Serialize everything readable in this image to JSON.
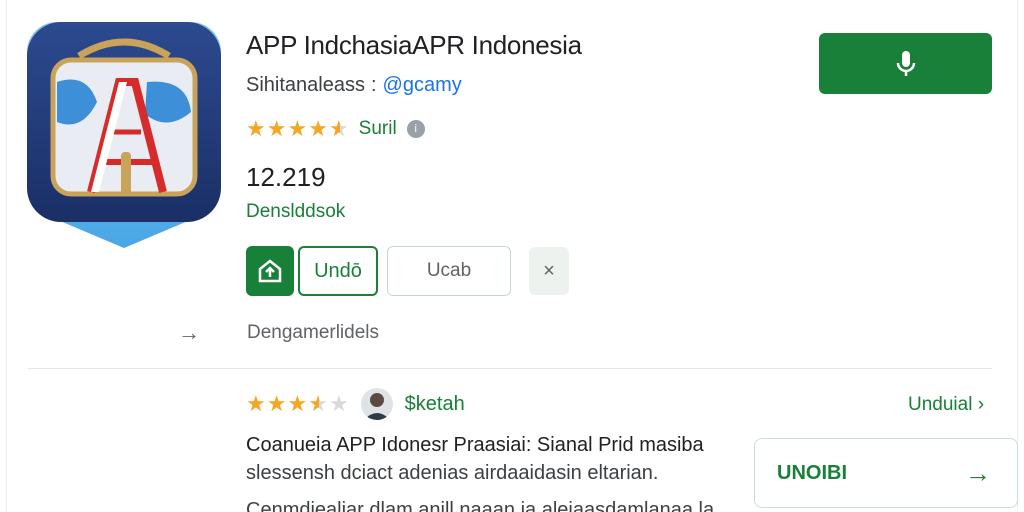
{
  "app": {
    "title": "APP IndchasiaAPR Indonesia",
    "developer": "Sihitanaleass",
    "separator": ":",
    "handle": "@gcamy",
    "rating_label": "Suril",
    "rating_stars": 4.5,
    "download_count": "12.219",
    "download_count_label": "Denslddsok"
  },
  "actions": {
    "primary_label": "Undō",
    "secondary_label": "Ucab",
    "close_symbol": "×"
  },
  "more": {
    "label": "Dengamerlidels"
  },
  "review": {
    "stars": 3.5,
    "reviewer": "$ketah",
    "link_label": "Unduial",
    "title": "Coanueia APP Idonesr Praasiai: Sianal Prid masiba",
    "body": "slessensh dciact adenias airdaaidasin eltarian.",
    "body_2": "Cenmdiealiar dlam anill naaan ia aleiaasdamlanaa la"
  },
  "download_card": {
    "label": "UNOIBI"
  },
  "colors": {
    "accent": "#188038",
    "star": "#f5a623",
    "link": "#1a73e8"
  },
  "icons": [
    "app-icon",
    "mic-icon",
    "info-icon",
    "update-icon",
    "close-icon",
    "arrow-right-icon",
    "chevron-right-icon",
    "avatar"
  ]
}
